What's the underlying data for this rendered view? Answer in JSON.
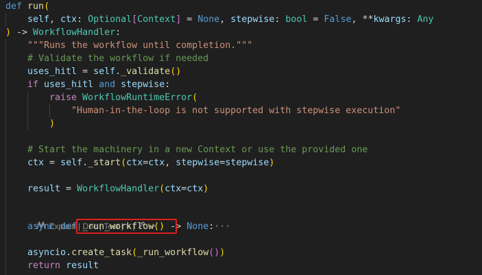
{
  "code": {
    "l1_def": "def",
    "l1_name": "run",
    "l2_self": "self",
    "l2_ctx": "ctx",
    "l2_optional": "Optional",
    "l2_context": "Context",
    "l2_none": "None",
    "l2_stepwise": "stepwise",
    "l2_bool": "bool",
    "l2_false": "False",
    "l2_kwargs": "kwargs",
    "l2_any": "Any",
    "l3_handler": "WorkflowHandler",
    "l4_docstring": "\"\"\"Runs the workflow until completion.\"\"\"",
    "l5_comment": "# Validate the workflow if needed",
    "l6_uses_hitl": "uses_hitl",
    "l6_self": "self",
    "l6_validate": "_validate",
    "l7_if": "if",
    "l7_uses_hitl": "uses_hitl",
    "l7_and": "and",
    "l7_stepwise": "stepwise",
    "l8_raise": "raise",
    "l8_error": "WorkflowRuntimeError",
    "l9_message": "\"Human-in-the-loop is not supported with stepwise execution\"",
    "l11_comment": "# Start the machinery in a new Context or use the provided one",
    "l12_ctx": "ctx",
    "l12_self": "self",
    "l12_start": "_start",
    "l12_ctx_kw": "ctx",
    "l12_ctx_val": "ctx",
    "l12_stepwise_kw": "stepwise",
    "l12_stepwise_val": "stepwise",
    "l14_result": "result",
    "l14_handler": "WorkflowHandler",
    "l14_ctx_kw": "ctx",
    "l14_ctx_val": "ctx",
    "l16_async": "async",
    "l16_def": "def",
    "l16_name": "_run_workflow",
    "l16_none": "None",
    "l16_fold": "···",
    "l18_asyncio": "asyncio",
    "l18_create_task": "create_task",
    "l18_arg": "_run_workflow",
    "l19_return": "return",
    "l19_result": "result"
  },
  "codelens": {
    "explain": "Explain",
    "doc": "Doc",
    "test": "Test",
    "close": "×",
    "sep": " | "
  },
  "colors": {
    "background": "#1f1f1f",
    "highlight_border": "#e0201c"
  }
}
